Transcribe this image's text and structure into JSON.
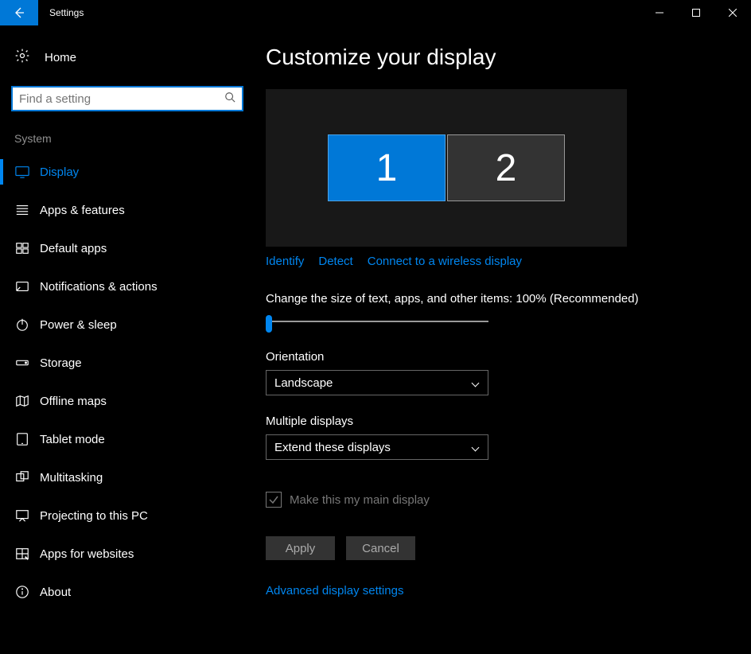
{
  "window": {
    "title": "Settings"
  },
  "sidebar": {
    "home": "Home",
    "search_placeholder": "Find a setting",
    "group": "System",
    "items": [
      {
        "label": "Display",
        "icon": "display",
        "active": true
      },
      {
        "label": "Apps & features",
        "icon": "apps"
      },
      {
        "label": "Default apps",
        "icon": "default-apps"
      },
      {
        "label": "Notifications & actions",
        "icon": "notifications"
      },
      {
        "label": "Power & sleep",
        "icon": "power"
      },
      {
        "label": "Storage",
        "icon": "storage"
      },
      {
        "label": "Offline maps",
        "icon": "maps"
      },
      {
        "label": "Tablet mode",
        "icon": "tablet"
      },
      {
        "label": "Multitasking",
        "icon": "multitasking"
      },
      {
        "label": "Projecting to this PC",
        "icon": "projecting"
      },
      {
        "label": "Apps for websites",
        "icon": "websites"
      },
      {
        "label": "About",
        "icon": "about"
      }
    ]
  },
  "main": {
    "title": "Customize your display",
    "monitors": {
      "primary": "1",
      "secondary": "2"
    },
    "links": {
      "identify": "Identify",
      "detect": "Detect",
      "wireless": "Connect to a wireless display"
    },
    "scale_label": "Change the size of text, apps, and other items: 100% (Recommended)",
    "orientation_label": "Orientation",
    "orientation_value": "Landscape",
    "multiple_label": "Multiple displays",
    "multiple_value": "Extend these displays",
    "main_display_label": "Make this my main display",
    "apply": "Apply",
    "cancel": "Cancel",
    "advanced": "Advanced display settings"
  }
}
